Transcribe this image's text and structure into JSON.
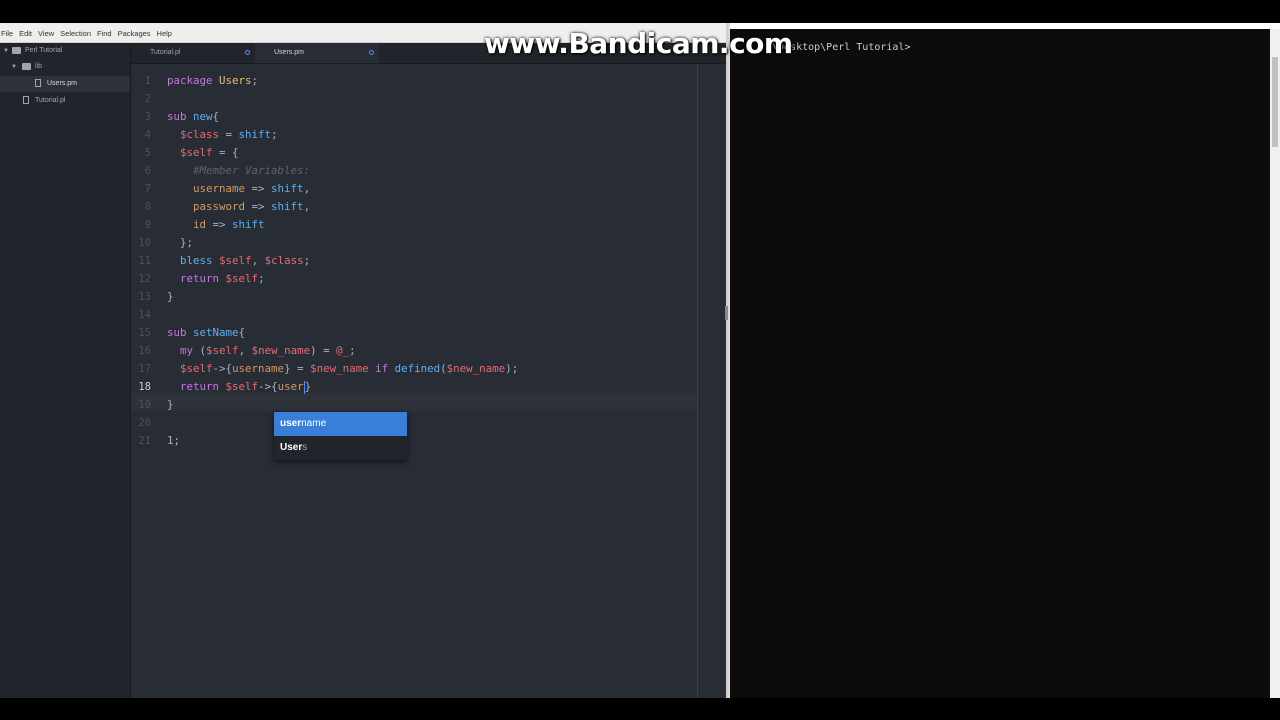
{
  "watermark": "www.Bandicam.com",
  "editor": {
    "menu": [
      "File",
      "Edit",
      "View",
      "Selection",
      "Find",
      "Packages",
      "Help"
    ],
    "tree": {
      "project": "Perl Tutorial",
      "folder": "lib",
      "files_in_folder": [
        "Users.pm"
      ],
      "root_files": [
        "Tutorial.pl"
      ]
    },
    "tabs": [
      {
        "label": "Tutorial.pl",
        "active": false
      },
      {
        "label": "Users.pm",
        "active": true
      }
    ],
    "current_line": 18,
    "line_numbers": [
      "1",
      "2",
      "3",
      "4",
      "5",
      "6",
      "7",
      "8",
      "9",
      "10",
      "11",
      "12",
      "13",
      "14",
      "15",
      "16",
      "17",
      "18",
      "19",
      "20",
      "21"
    ],
    "code_lines": [
      [
        [
          "kw",
          "package"
        ],
        [
          "plain",
          " "
        ],
        [
          "typ",
          "Users"
        ],
        [
          "plain",
          ";"
        ]
      ],
      [],
      [
        [
          "kw",
          "sub"
        ],
        [
          "plain",
          " "
        ],
        [
          "fn",
          "new"
        ],
        [
          "plain",
          "{"
        ]
      ],
      [
        [
          "plain",
          "  "
        ],
        [
          "var",
          "$class"
        ],
        [
          "plain",
          " = "
        ],
        [
          "fn",
          "shift"
        ],
        [
          "plain",
          ";"
        ]
      ],
      [
        [
          "plain",
          "  "
        ],
        [
          "var",
          "$self"
        ],
        [
          "plain",
          " = {"
        ]
      ],
      [
        [
          "plain",
          "    "
        ],
        [
          "cmt",
          "#Member Variables:"
        ]
      ],
      [
        [
          "plain",
          "    "
        ],
        [
          "key",
          "username"
        ],
        [
          "plain",
          " => "
        ],
        [
          "fn",
          "shift"
        ],
        [
          "plain",
          ","
        ]
      ],
      [
        [
          "plain",
          "    "
        ],
        [
          "key",
          "password"
        ],
        [
          "plain",
          " => "
        ],
        [
          "fn",
          "shift"
        ],
        [
          "plain",
          ","
        ]
      ],
      [
        [
          "plain",
          "    "
        ],
        [
          "key",
          "id"
        ],
        [
          "plain",
          " => "
        ],
        [
          "fn",
          "shift"
        ]
      ],
      [
        [
          "plain",
          "  };"
        ]
      ],
      [
        [
          "plain",
          "  "
        ],
        [
          "fn",
          "bless"
        ],
        [
          "plain",
          " "
        ],
        [
          "var",
          "$self"
        ],
        [
          "plain",
          ", "
        ],
        [
          "var",
          "$class"
        ],
        [
          "plain",
          ";"
        ]
      ],
      [
        [
          "plain",
          "  "
        ],
        [
          "kw",
          "return"
        ],
        [
          "plain",
          " "
        ],
        [
          "var",
          "$self"
        ],
        [
          "plain",
          ";"
        ]
      ],
      [
        [
          "plain",
          "}"
        ]
      ],
      [],
      [
        [
          "kw",
          "sub"
        ],
        [
          "plain",
          " "
        ],
        [
          "fn",
          "setName"
        ],
        [
          "plain",
          "{"
        ]
      ],
      [
        [
          "plain",
          "  "
        ],
        [
          "kw",
          "my"
        ],
        [
          "plain",
          " ("
        ],
        [
          "var",
          "$self"
        ],
        [
          "plain",
          ", "
        ],
        [
          "var",
          "$new_name"
        ],
        [
          "plain",
          ") = "
        ],
        [
          "var",
          "@_"
        ],
        [
          "plain",
          ";"
        ]
      ],
      [
        [
          "plain",
          "  "
        ],
        [
          "var",
          "$self"
        ],
        [
          "plain",
          "->{"
        ],
        [
          "key",
          "username"
        ],
        [
          "plain",
          "} = "
        ],
        [
          "var",
          "$new_name"
        ],
        [
          "plain",
          " "
        ],
        [
          "kw",
          "if"
        ],
        [
          "plain",
          " "
        ],
        [
          "fn",
          "defined"
        ],
        [
          "plain",
          "("
        ],
        [
          "var",
          "$new_name"
        ],
        [
          "plain",
          ");"
        ]
      ],
      [
        [
          "plain",
          "  "
        ],
        [
          "kw",
          "return"
        ],
        [
          "plain",
          " "
        ],
        [
          "var",
          "$self"
        ],
        [
          "plain",
          "->{"
        ],
        [
          "key",
          "user"
        ],
        [
          "cursor",
          ""
        ],
        [
          "plain",
          "}"
        ]
      ],
      [
        [
          "plain",
          "}"
        ]
      ],
      [],
      [
        [
          "plain",
          "1;"
        ]
      ]
    ],
    "autocomplete": [
      {
        "match": "user",
        "rest": "name",
        "selected": true
      },
      {
        "match": "User",
        "rest": "s",
        "selected": false
      }
    ]
  },
  "console": {
    "prompt_visible": "\\Desktop\\Perl Tutorial>"
  }
}
